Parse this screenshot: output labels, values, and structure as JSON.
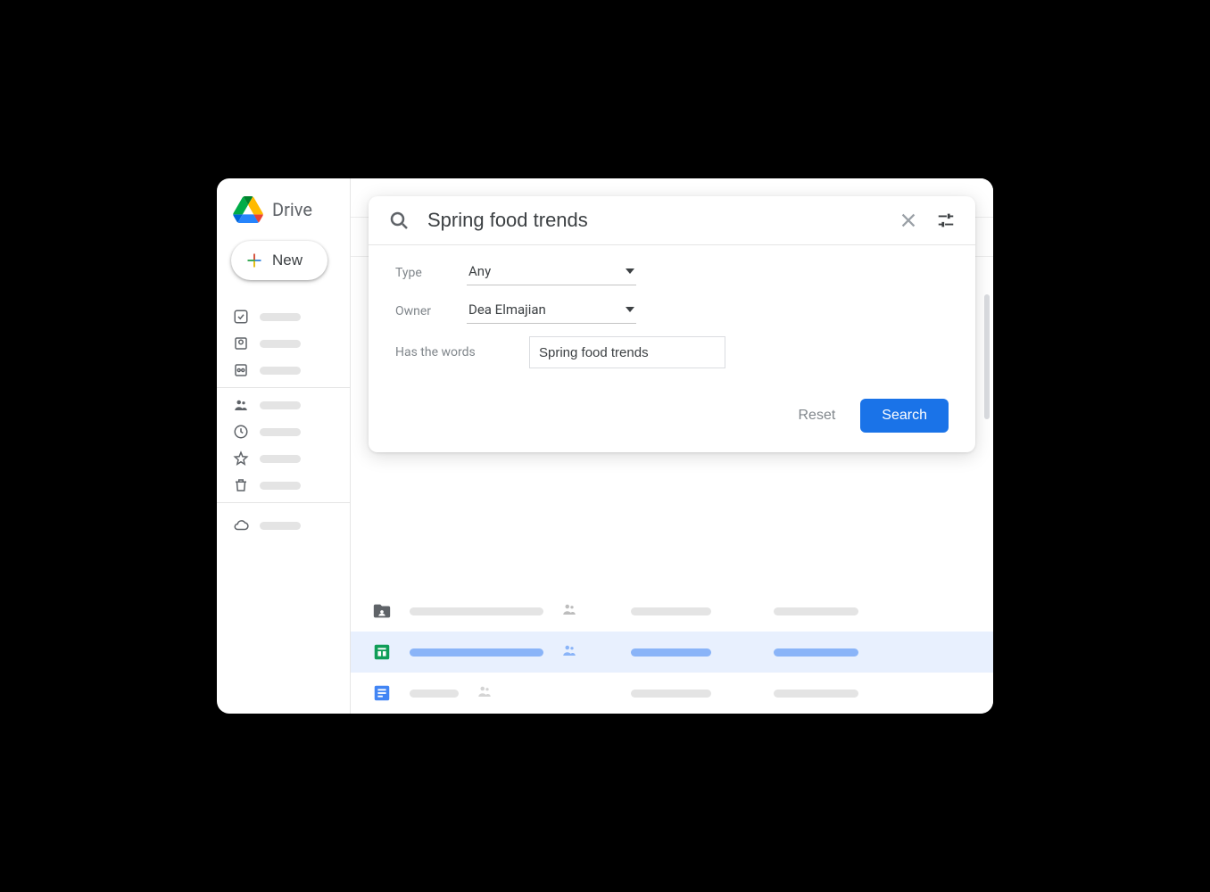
{
  "header": {
    "product": "Drive",
    "newButton": "New"
  },
  "search": {
    "query": "Spring food trends",
    "filters": {
      "typeLabel": "Type",
      "typeValue": "Any",
      "ownerLabel": "Owner",
      "ownerValue": "Dea Elmajian",
      "wordsLabel": "Has the words",
      "wordsValue": "Spring food trends"
    },
    "resetLabel": "Reset",
    "searchLabel": "Search"
  },
  "sidebar": {
    "icons": [
      "priority",
      "my-drive",
      "shared-drives",
      "shared",
      "recent",
      "starred",
      "trash",
      "storage"
    ]
  },
  "files": [
    {
      "type": "folder",
      "shared": true,
      "selected": false
    },
    {
      "type": "sheets",
      "shared": true,
      "selected": true
    },
    {
      "type": "docs",
      "shared": true,
      "selected": false
    }
  ]
}
